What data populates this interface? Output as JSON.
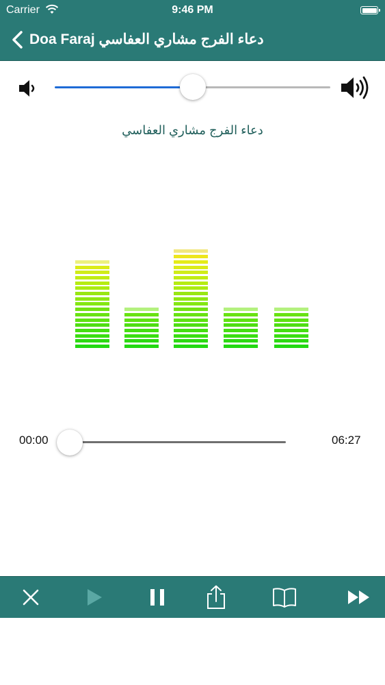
{
  "status_bar": {
    "carrier": "Carrier",
    "time": "9:46 PM"
  },
  "nav": {
    "title": "Doa Faraj  دعاء الفرج مشاري العفاسي"
  },
  "volume": {
    "level_percent": 50
  },
  "player": {
    "track_title": "دعاء الفرج مشاري العفاسي",
    "elapsed": "00:00",
    "duration": "06:27",
    "progress_percent": 0
  },
  "equalizer": {
    "bar_levels": [
      17,
      8,
      19,
      8,
      8
    ],
    "max_level": 19
  },
  "toolbar": {
    "buttons": [
      "close-icon",
      "play-icon",
      "pause-icon",
      "share-icon",
      "book-icon",
      "fast-forward-icon"
    ]
  },
  "colors": {
    "brand": "#2a7a76",
    "slider_fill": "#1e6bd6",
    "slider_track": "#b8b8b8",
    "play_disabled": "#5aa8a4"
  }
}
